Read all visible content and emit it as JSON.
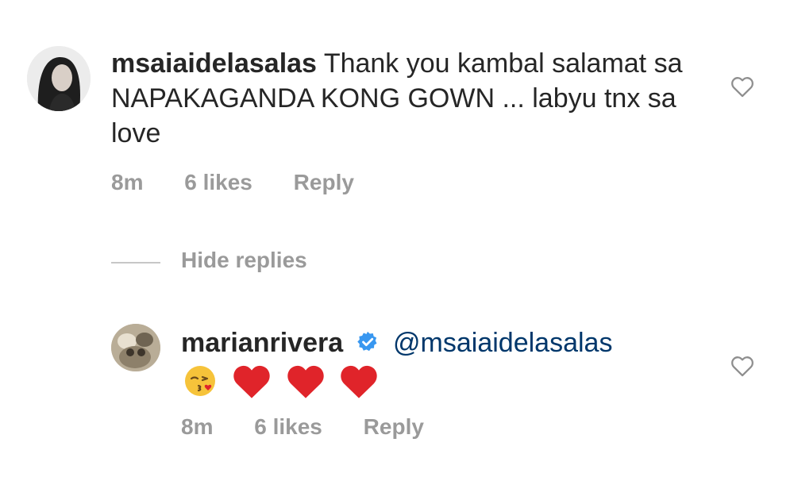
{
  "comments": [
    {
      "username": "msaiaidelasalas",
      "text": "Thank you kambal salamat sa NAPAKAGANDA KONG GOWN ... labyu tnx sa love",
      "time": "8m",
      "likes": "6 likes",
      "reply": "Reply"
    },
    {
      "username": "marianrivera",
      "mention": "@msaiaidelasalas",
      "time": "8m",
      "likes": "6 likes",
      "reply": "Reply"
    }
  ],
  "replies_toggle": "Hide replies",
  "colors": {
    "mention": "#00376b",
    "verified": "#3897f0",
    "heart": "#e0242a",
    "meta": "#9a9a9a"
  },
  "icons": [
    "heart-outline-icon",
    "verified-badge-icon",
    "kiss-face-emoji",
    "red-heart-emoji"
  ]
}
